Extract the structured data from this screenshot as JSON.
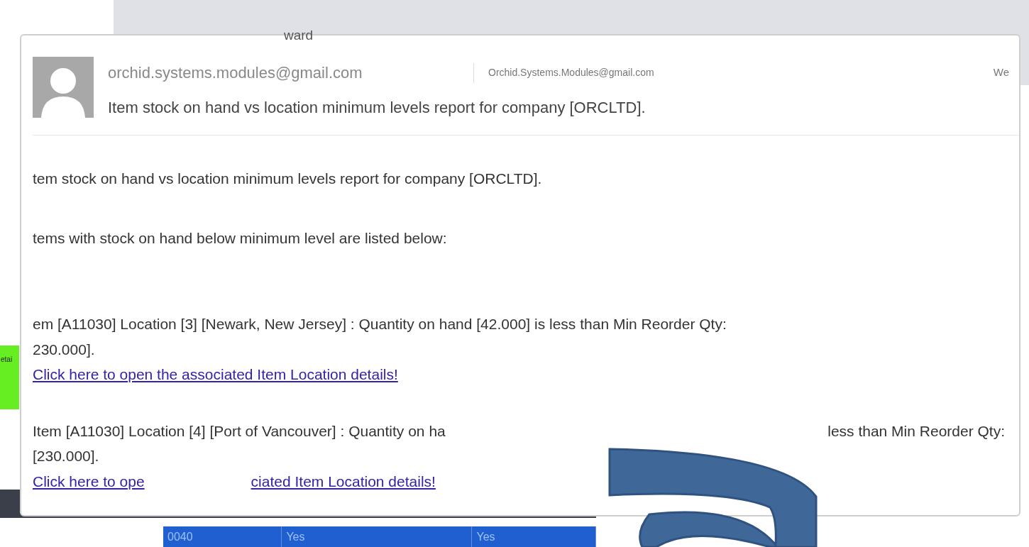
{
  "toolbar": {
    "label": "ward"
  },
  "background": {
    "button_fragment": "etai",
    "grid_cells": [
      "0040",
      "Yes",
      "Yes"
    ]
  },
  "header": {
    "sender": "orchid.systems.modules@gmail.com",
    "recipient": "Orchid.Systems.Modules@gmail.com",
    "date": "We",
    "subject": "Item stock on hand vs location minimum levels report for company [ORCLTD]."
  },
  "body": {
    "intro": "tem stock on hand vs location minimum levels report for company [ORCLTD].",
    "lead": "tems with stock on hand below minimum level are listed below:",
    "items": [
      {
        "line_start": "em [A11030] Location [3] [Newark, New Jersey] : Quantity on hand [42.000] is less than Min Reorder Qty:",
        "qty": "230.000].",
        "link": [
          "Click here to open the associated Item Location details!"
        ]
      },
      {
        "line_start": "Item [A11030] Location [4] [Port of Vancouver] : Quantity on ha",
        "line_end": "less than Min Reorder Qty:",
        "qty": "[230.000].",
        "link": [
          "Click here to ope",
          "ciated Item Location details!"
        ]
      }
    ]
  }
}
